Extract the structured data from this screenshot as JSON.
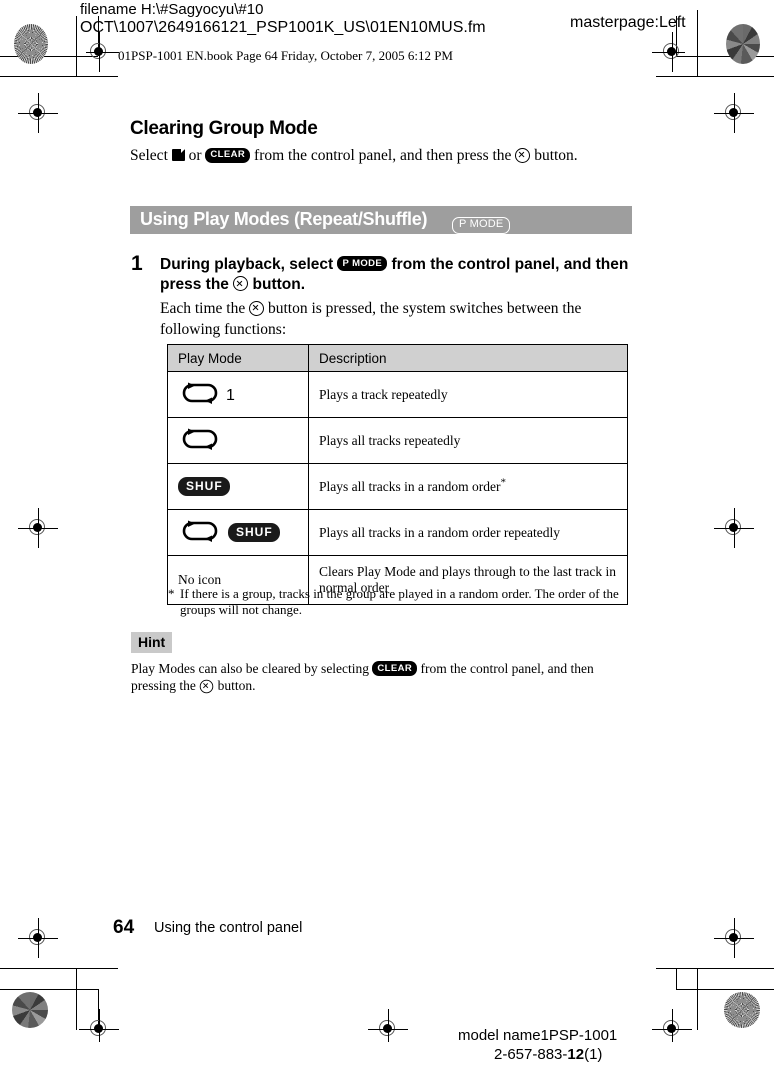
{
  "prepress": {
    "filename_line1": "filename H:\\#Sagyocyu\\#10",
    "filename_line2": "OCT\\1007\\2649166121_PSP1001K_US\\01EN10MUS.fm",
    "masterpage": "masterpage:Left",
    "bookline": "01PSP-1001 EN.book  Page 64  Friday, October 7, 2005  6:12 PM"
  },
  "content": {
    "section_title": "Clearing Group Mode",
    "clearing": {
      "part1": "Select ",
      "part2": " or ",
      "clear_badge": "CLEAR",
      "part3": " from the control panel, and then press the ",
      "part4": " button."
    },
    "band": {
      "title": "Using Play Modes (Repeat/Shuffle)",
      "badge": "P MODE"
    },
    "step": {
      "number": "1",
      "text_part1": "During playback, select ",
      "badge": "P MODE",
      "text_part2": " from the control panel, and then press the ",
      "text_part3": " button.",
      "sub_part1": "Each time the ",
      "sub_part2": " button is pressed, the system switches between the following functions:"
    },
    "table": {
      "headers": [
        "Play Mode",
        "Description"
      ],
      "rows": [
        {
          "icon": "repeat-one-icon",
          "icon_label": "1",
          "description": "Plays a track repeatedly",
          "footnote_marker": ""
        },
        {
          "icon": "repeat-all-icon",
          "icon_label": "",
          "description": "Plays all tracks repeatedly",
          "footnote_marker": ""
        },
        {
          "icon": "shuffle-icon",
          "icon_label": "SHUF",
          "description": "Plays all tracks in a random order",
          "footnote_marker": "*"
        },
        {
          "icon": "repeat-shuffle-icon",
          "icon_label": "SHUF",
          "description": "Plays all tracks in a random order repeatedly",
          "footnote_marker": ""
        },
        {
          "icon": "no-icon",
          "icon_label": "No icon",
          "description": "Clears Play Mode and plays through to the last track in normal order",
          "footnote_marker": ""
        }
      ]
    },
    "footnote": {
      "marker": "*",
      "text": "If there is a group, tracks in the group are played in a random order. The order of the groups will not change."
    },
    "hint": {
      "label": "Hint",
      "part1": "Play Modes can also be cleared by selecting ",
      "clear_badge": "CLEAR",
      "part2": " from the control panel, and then pressing the ",
      "part3": " button."
    }
  },
  "footer": {
    "page_number": "64",
    "chapter": "Using the control panel",
    "model_name": "model name1PSP-1001",
    "doc_number_prefix": "2-657-883-",
    "doc_number_bold": "12",
    "doc_number_suffix": "(1)"
  }
}
